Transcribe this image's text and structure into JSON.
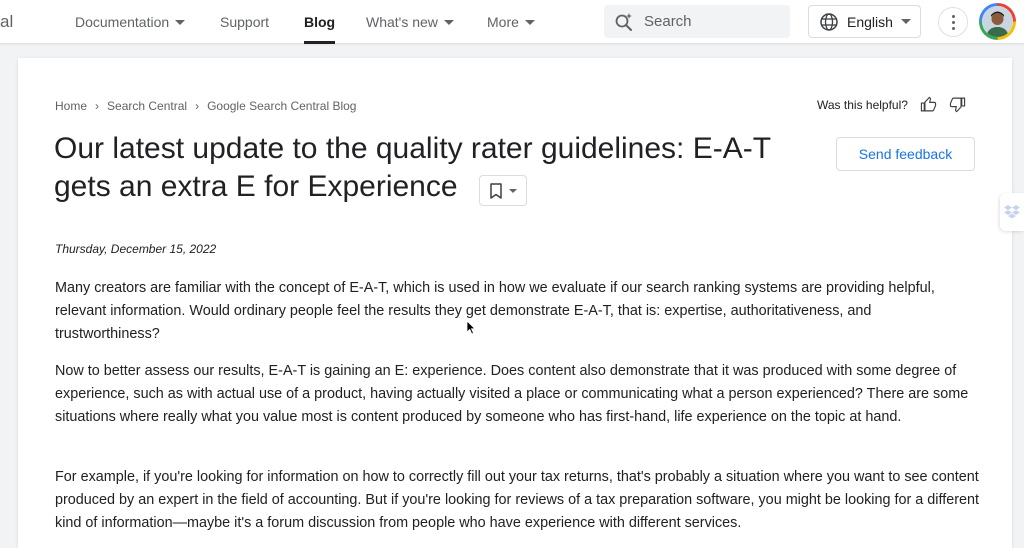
{
  "header": {
    "logo_fragment": "al",
    "nav": [
      {
        "label": "Documentation",
        "has_caret": true
      },
      {
        "label": "Support",
        "has_caret": false
      },
      {
        "label": "Blog",
        "has_caret": false,
        "active": true
      },
      {
        "label": "What's new",
        "has_caret": true
      },
      {
        "label": "More",
        "has_caret": true
      }
    ],
    "search": {
      "placeholder": "Search"
    },
    "language": {
      "label": "English"
    },
    "icons": {
      "search": "search-spark-icon",
      "language": "globe-icon",
      "more": "more-vert-icon",
      "account": "avatar"
    }
  },
  "article": {
    "breadcrumb": [
      "Home",
      "Search Central",
      "Google Search Central Blog"
    ],
    "helpful_label": "Was this helpful?",
    "title_line1": "Our latest update to the quality rater guidelines: E-A-T",
    "title_line2": "gets an extra E for Experience",
    "send_feedback": "Send feedback",
    "date": "Thursday, December 15, 2022",
    "paragraphs": [
      "Many creators are familiar with the concept of E-A-T, which is used in how we evaluate if our search ranking systems are providing helpful, relevant information. Would ordinary people feel the results they get demonstrate E-A-T, that is: expertise, authoritativeness, and trustworthiness?",
      "Now to better assess our results, E-A-T is gaining an E: experience. Does content also demonstrate that it was produced with some degree of experience, such as with actual use of a product, having actually visited a place or communicating what a person experienced? There are some situations where really what you value most is content produced by someone who has first-hand, life experience on the topic at hand.",
      "For example, if you're looking for information on how to correctly fill out your tax returns, that's probably a situation where you want to see content produced by an expert in the field of accounting. But if you're looking for reviews of a tax preparation software, you might be looking for a different kind of information—maybe it's a forum discussion from people who have experience with different services."
    ]
  },
  "colors": {
    "link_blue": "#1a73e8",
    "text": "#202124",
    "muted": "#5f6368",
    "page_bg": "#f1f3f4"
  }
}
